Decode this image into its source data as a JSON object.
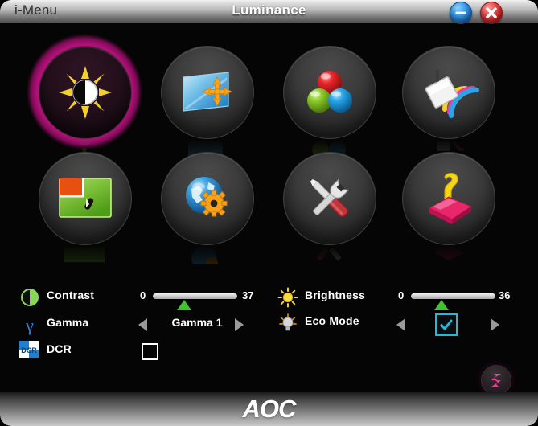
{
  "titlebar": {
    "app_name": "i-Menu",
    "window_title": "Luminance",
    "minimize_icon": "minimize-icon",
    "close_icon": "close-icon"
  },
  "icon_grid": {
    "items": [
      {
        "name": "luminance",
        "icon": "sun-contrast-icon",
        "active": true
      },
      {
        "name": "image-setup",
        "icon": "screen-move-arrows-icon",
        "active": false
      },
      {
        "name": "color-setup",
        "icon": "rgb-spheres-icon",
        "active": false
      },
      {
        "name": "picture-boost",
        "icon": "paint-bucket-rainbow-icon",
        "active": false
      },
      {
        "name": "osd-setup",
        "icon": "green-screen-cursor-icon",
        "active": false
      },
      {
        "name": "extra-language",
        "icon": "globe-gear-icon",
        "active": false
      },
      {
        "name": "tools",
        "icon": "wrench-screwdriver-icon",
        "active": false
      },
      {
        "name": "help-info",
        "icon": "pink-book-question-icon",
        "active": false
      }
    ]
  },
  "controls": {
    "contrast": {
      "icon": "contrast-half-circle-icon",
      "label": "Contrast",
      "min": "0",
      "max": "37",
      "value": 37,
      "range_min": 0,
      "range_max": 100
    },
    "gamma": {
      "icon": "gamma-letter-icon",
      "label": "Gamma",
      "value": "Gamma 1",
      "prev_icon": "arrow-left-icon",
      "next_icon": "arrow-right-icon"
    },
    "dcr": {
      "icon": "dcr-badge-icon",
      "label": "DCR",
      "checked": false
    },
    "brightness": {
      "icon": "sun-icon",
      "label": "Brightness",
      "min": "0",
      "max": "36",
      "value": 36,
      "range_min": 0,
      "range_max": 100
    },
    "eco_mode": {
      "icon": "eco-bulb-icon",
      "label": "Eco Mode",
      "checked": true,
      "prev_icon": "arrow-left-icon",
      "next_icon": "arrow-right-icon"
    }
  },
  "reset_button": {
    "icon": "reset-arrows-icon"
  },
  "footer": {
    "brand": "AOC"
  },
  "colors": {
    "accent_pink": "#ec15a0",
    "slider_thumb_green": "#3fc42e",
    "eco_cyan": "#27b7d8",
    "titlebar_text": "#2b2b2b"
  }
}
